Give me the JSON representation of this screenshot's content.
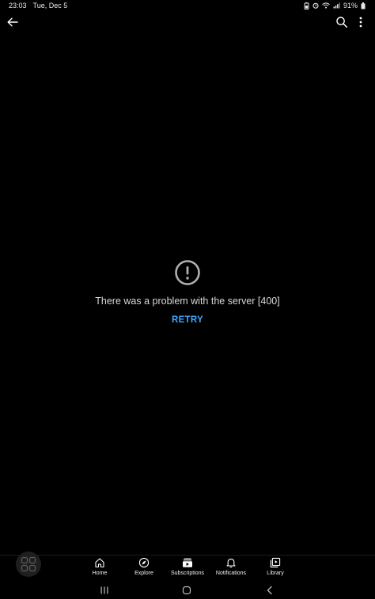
{
  "status_bar": {
    "time": "23:03",
    "date": "Tue, Dec 5",
    "battery": "91%",
    "icons": [
      "battery-saver-icon",
      "alarm-icon",
      "wifi-icon",
      "signal-icon"
    ]
  },
  "app_bar": {
    "back_icon": "arrow-left-icon",
    "search_icon": "search-icon",
    "more_icon": "more-vert-icon"
  },
  "error": {
    "icon": "error-circle-icon",
    "message": "There was a problem with the server [400]",
    "retry_label": "RETRY"
  },
  "colors": {
    "background": "#000000",
    "accent": "#3ea6ff",
    "text": "#d6d6d6"
  },
  "bottom_nav": {
    "items": [
      {
        "label": "Home",
        "icon": "home-icon"
      },
      {
        "label": "Explore",
        "icon": "compass-icon"
      },
      {
        "label": "Subscriptions",
        "icon": "subscriptions-icon"
      },
      {
        "label": "Notifications",
        "icon": "bell-icon"
      },
      {
        "label": "Library",
        "icon": "library-icon"
      }
    ]
  },
  "floating_button": {
    "icon": "grid-icon"
  },
  "system_nav": {
    "recents_icon": "recents-icon",
    "home_icon": "system-home-icon",
    "back_icon": "system-back-icon"
  }
}
